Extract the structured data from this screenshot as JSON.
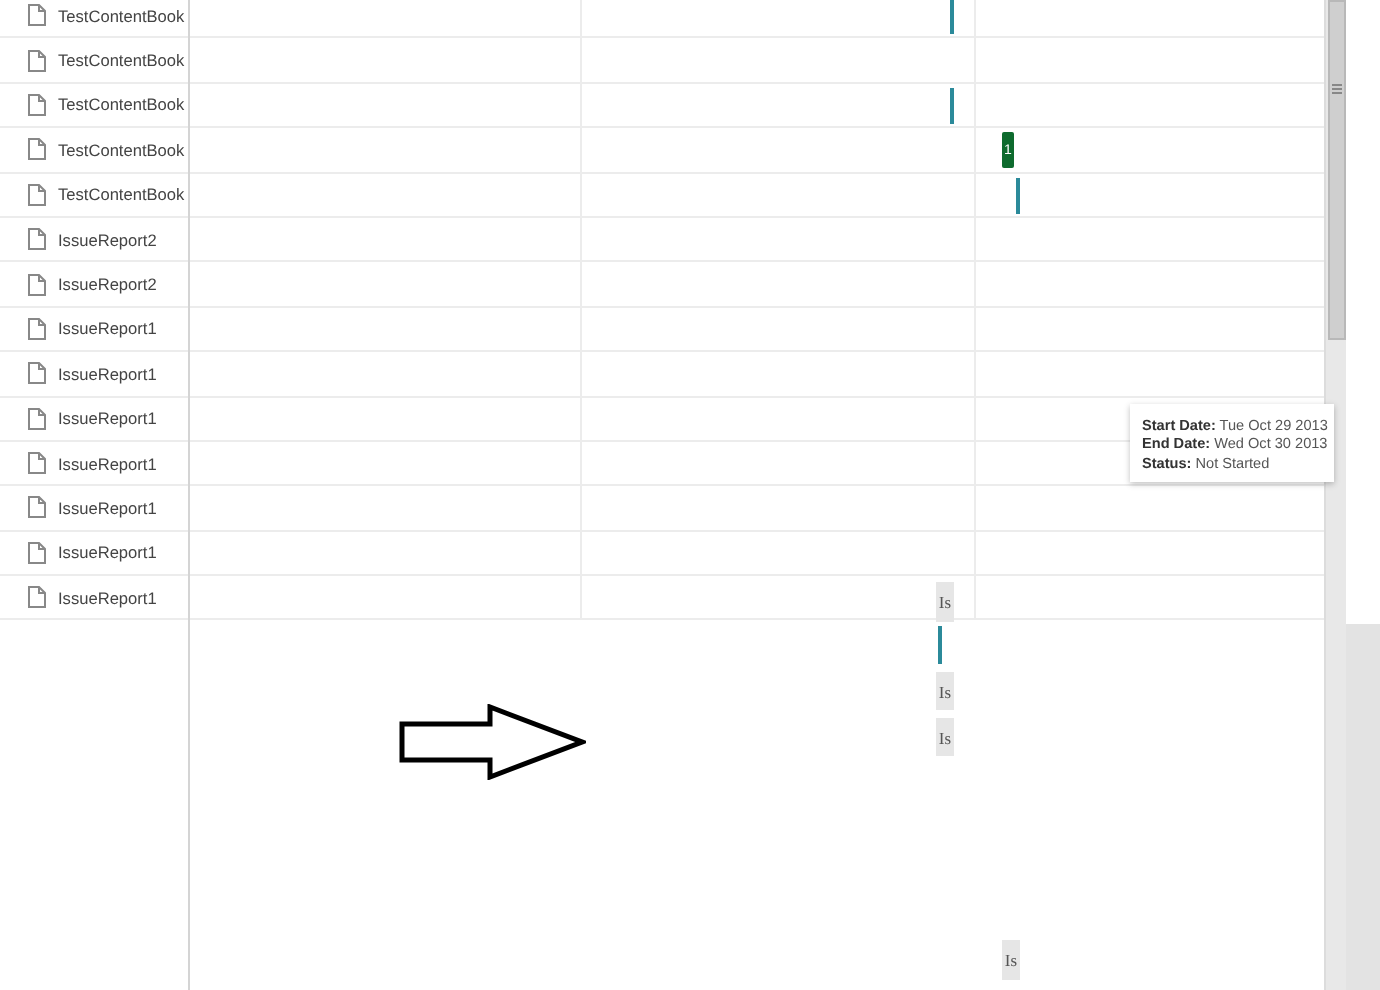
{
  "tree": {
    "rows": [
      {
        "label": "TestContentBook"
      },
      {
        "label": "TestContentBook"
      },
      {
        "label": "TestContentBook"
      },
      {
        "label": "TestContentBook"
      },
      {
        "label": "TestContentBook"
      },
      {
        "label": "IssueReport2"
      },
      {
        "label": "IssueReport2"
      },
      {
        "label": "IssueReport1"
      },
      {
        "label": "IssueReport1"
      },
      {
        "label": "IssueReport1"
      },
      {
        "label": "IssueReport1"
      },
      {
        "label": "IssueReport1"
      },
      {
        "label": "IssueReport1"
      },
      {
        "label": "IssueReport1"
      }
    ]
  },
  "gantt": {
    "marks": [
      {
        "kind": "line"
      },
      {
        "kind": "line"
      },
      {
        "kind": "bar",
        "text": "1"
      },
      {
        "kind": "line"
      },
      {
        "kind": "label",
        "text": "Is"
      },
      {
        "kind": "line"
      },
      {
        "kind": "label",
        "text": "Is"
      },
      {
        "kind": "label",
        "text": "Is"
      },
      {
        "kind": "label",
        "text": "Is"
      }
    ]
  },
  "tooltip": {
    "fields": [
      {
        "label": "Start Date:",
        "value": "Tue Oct 29 2013"
      },
      {
        "label": "End Date:",
        "value": "Wed Oct 30 2013"
      },
      {
        "label": "Status:",
        "value": "Not Started"
      }
    ]
  }
}
